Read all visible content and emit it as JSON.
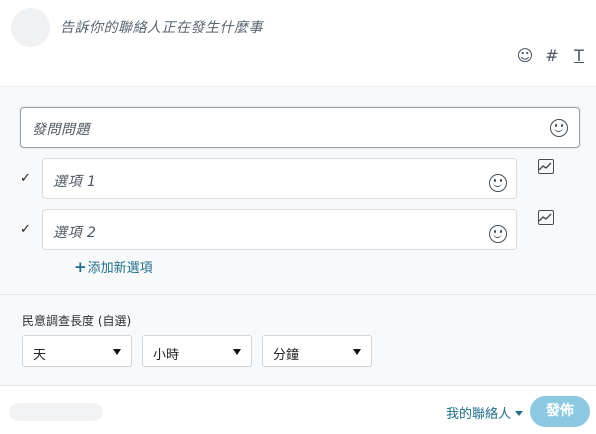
{
  "composer": {
    "prompt": "告訴你的聯絡人正在發生什麼事",
    "toolbar": {
      "emoji_glyph": "☺",
      "hashtag_glyph": "#",
      "text_format_glyph": "T"
    }
  },
  "poll": {
    "question_placeholder": "發問問題",
    "options": [
      {
        "placeholder": "選項 1",
        "check": "✓"
      },
      {
        "placeholder": "選項 2",
        "check": "✓"
      }
    ],
    "add_option_plus": "+",
    "add_option_label": "添加新選項"
  },
  "duration": {
    "label": "民意調查長度 (自選)",
    "day": "天",
    "hour": "小時",
    "minute": "分鐘"
  },
  "footer": {
    "audience": "我的聯絡人",
    "post_label": "發佈"
  },
  "colors": {
    "accent": "#1f6f8b",
    "post_button": "#8cc9e0",
    "panel_bg": "#f8f9fa"
  },
  "icons": [
    "emoji-icon",
    "hashtag-icon",
    "text-format-icon",
    "image-icon",
    "check-icon",
    "caret-down-icon"
  ]
}
